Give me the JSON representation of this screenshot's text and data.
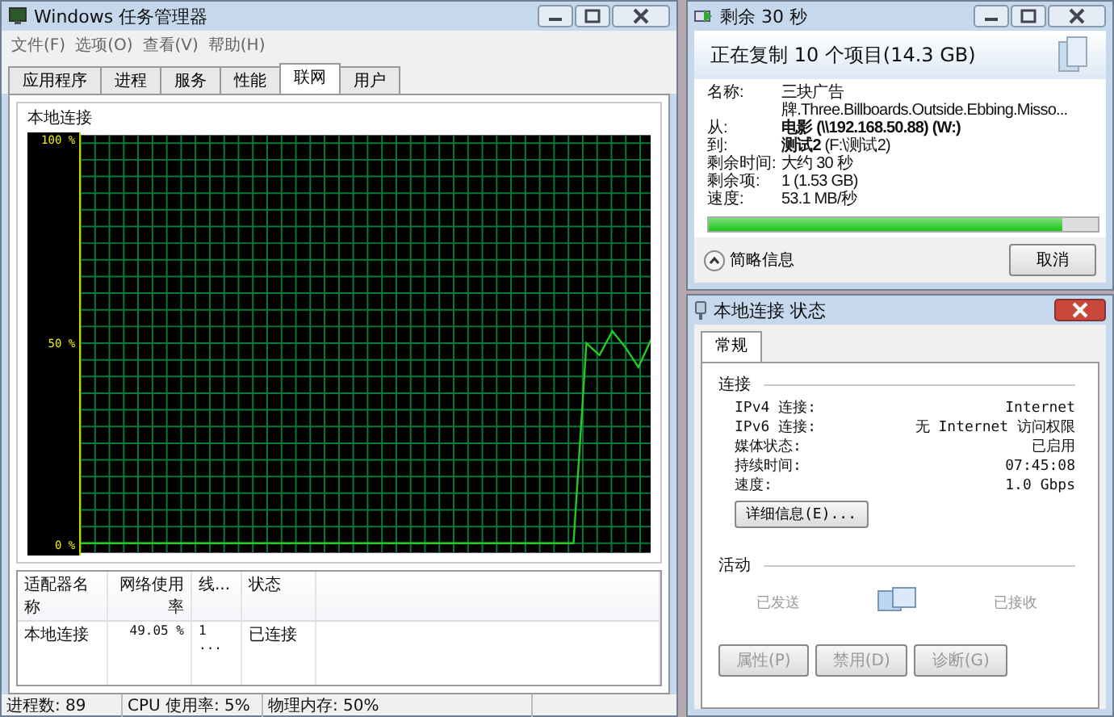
{
  "task_manager": {
    "title": "Windows 任务管理器",
    "menu": [
      "文件(F)",
      "选项(O)",
      "查看(V)",
      "帮助(H)"
    ],
    "tabs": [
      {
        "label": "应用程序",
        "selected": false
      },
      {
        "label": "进程",
        "selected": false
      },
      {
        "label": "服务",
        "selected": false
      },
      {
        "label": "性能",
        "selected": false
      },
      {
        "label": "联网",
        "selected": true
      },
      {
        "label": "用户",
        "selected": false
      }
    ],
    "group_label": "本地连接",
    "chart_data": {
      "type": "line",
      "grid": true,
      "ylim": [
        0,
        100
      ],
      "yticks": [
        {
          "value": 0,
          "label": "0 %"
        },
        {
          "value": 50,
          "label": "50 %"
        },
        {
          "value": 100,
          "label": "100 %"
        }
      ],
      "series": [
        {
          "color": "#22cc22",
          "values": [
            0,
            0,
            0,
            0,
            0,
            0,
            0,
            0,
            0,
            0,
            0,
            0,
            0,
            0,
            0,
            0,
            0,
            0,
            0,
            0,
            0,
            0,
            0,
            0,
            0,
            0,
            0,
            0,
            0,
            0,
            0,
            0,
            0,
            0,
            0,
            0,
            0,
            0,
            0,
            50,
            47,
            53,
            49,
            44,
            51
          ]
        }
      ]
    },
    "table": {
      "columns": [
        "适配器名称",
        "网络使用率",
        "线...",
        "状态"
      ],
      "rows": [
        [
          "本地连接",
          "49.05 %",
          "1 ...",
          "已连接"
        ]
      ]
    },
    "status_bar": [
      "进程数: 89",
      "CPU 使用率: 5%",
      "物理内存: 50%"
    ]
  },
  "copy_dialog": {
    "title": "剩余 30 秒",
    "heading": "正在复制 10 个项目(14.3 GB)",
    "details": [
      {
        "label": "名称:",
        "value": "三块广告牌.Three.Billboards.Outside.Ebbing.Misso...",
        "bold": false
      },
      {
        "label": "从:",
        "value": "电影 (\\\\192.168.50.88) (W:)",
        "bold": true
      },
      {
        "label": "到:",
        "value": "**测试2** (F:\\测试2)",
        "bold": false
      },
      {
        "label": "剩余时间:",
        "value": "大约 30 秒",
        "bold": false
      },
      {
        "label": "剩余项:",
        "value": "1 (1.53 GB)",
        "bold": false
      },
      {
        "label": "速度:",
        "value": "53.1 MB/秒",
        "bold": false
      }
    ],
    "progress": {
      "level": 0.91
    },
    "details_toggle": "简略信息",
    "cancel_button": "取消"
  },
  "status_dialog": {
    "title": "本地连接 状态",
    "tabs": [
      {
        "label": "常规",
        "selected": true
      }
    ],
    "connection_heading": "连接",
    "rows": [
      {
        "label": "IPv4 连接:",
        "value": "Internet"
      },
      {
        "label": "IPv6 连接:",
        "value": "无 Internet 访问权限"
      },
      {
        "label": "媒体状态:",
        "value": "已启用"
      },
      {
        "label": "持续时间:",
        "value": "07:45:08"
      },
      {
        "label": "速度:",
        "value": "1.0 Gbps"
      }
    ],
    "details_button": "详细信息(E)...",
    "activity_heading": "活动",
    "sent_label": "已发送",
    "received_label": "已接收",
    "buttons": [
      "属性(P)",
      "禁用(D)",
      "诊断(G)"
    ]
  }
}
